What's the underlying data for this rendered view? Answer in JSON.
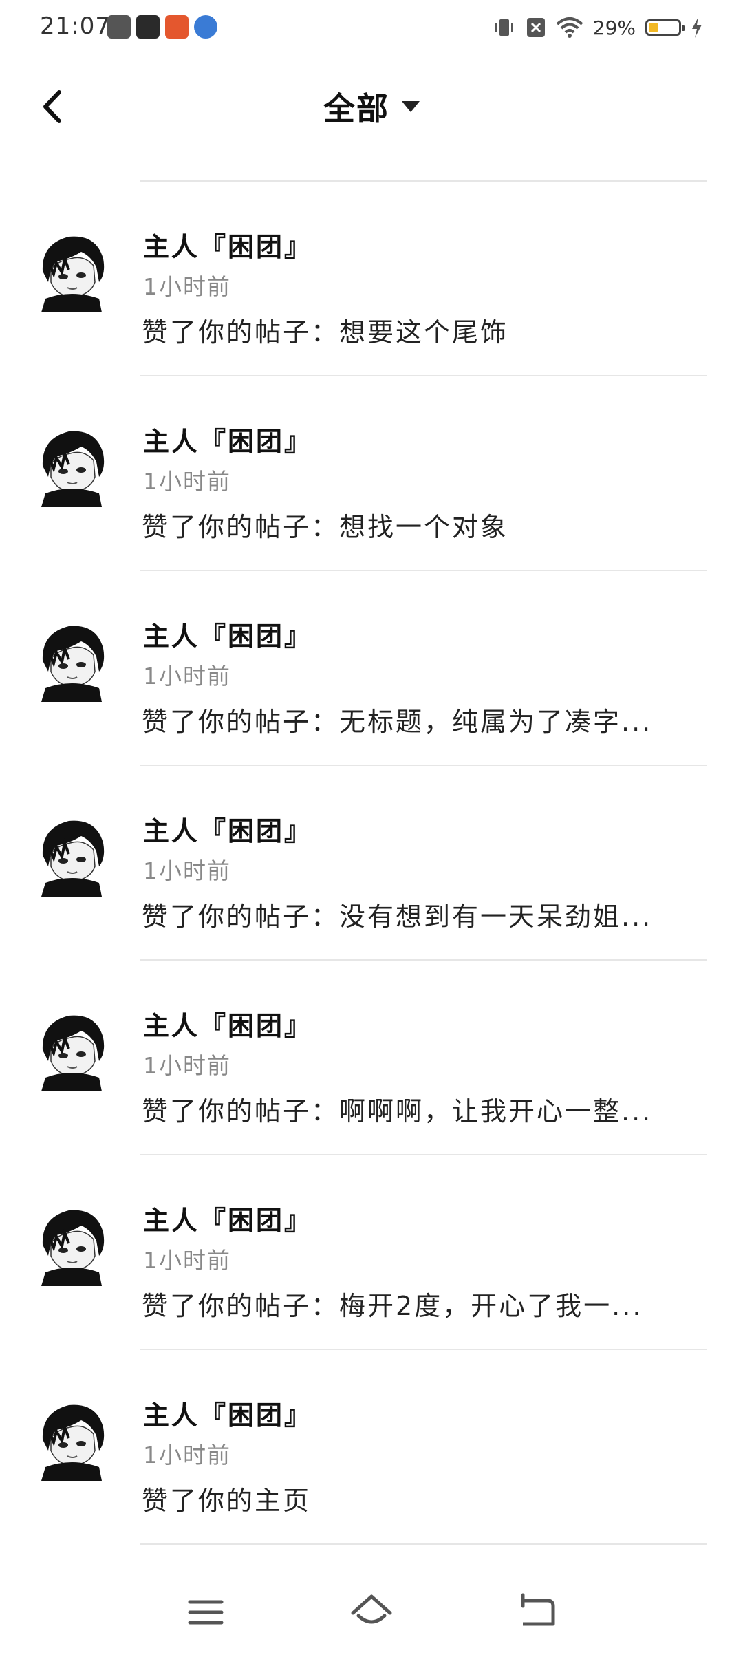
{
  "status_bar": {
    "time": "21:07",
    "battery_percent": "29%",
    "battery_level": 0.29,
    "icons": [
      "app-icon-1",
      "app-icon-2",
      "app-icon-3",
      "app-icon-4",
      "vibrate-icon",
      "sim-off-icon",
      "wifi-icon",
      "battery-icon",
      "charging-icon"
    ]
  },
  "header": {
    "back_icon": "chevron-left-icon",
    "title": "全部",
    "dropdown_icon": "caret-down-icon"
  },
  "notifications": [
    {
      "name": "主人『困团』",
      "time": "1小时前",
      "content": "赞了你的帖子：想要这个尾饰"
    },
    {
      "name": "主人『困团』",
      "time": "1小时前",
      "content": "赞了你的帖子：想找一个对象"
    },
    {
      "name": "主人『困团』",
      "time": "1小时前",
      "content": "赞了你的帖子：无标题，纯属为了凑字..."
    },
    {
      "name": "主人『困团』",
      "time": "1小时前",
      "content": "赞了你的帖子：没有想到有一天呆劲姐..."
    },
    {
      "name": "主人『困团』",
      "time": "1小时前",
      "content": "赞了你的帖子：啊啊啊，让我开心一整..."
    },
    {
      "name": "主人『困团』",
      "time": "1小时前",
      "content": "赞了你的帖子：梅开2度，开心了我一..."
    },
    {
      "name": "主人『困团』",
      "time": "1小时前",
      "content": "赞了你的主页"
    }
  ],
  "nav_bar": {
    "icons": [
      "menu-icon",
      "home-icon",
      "back-icon"
    ]
  },
  "colors": {
    "background": "#ffffff",
    "divider": "#e6e6e6",
    "secondary_text": "#888888",
    "battery": "#f2b824"
  }
}
